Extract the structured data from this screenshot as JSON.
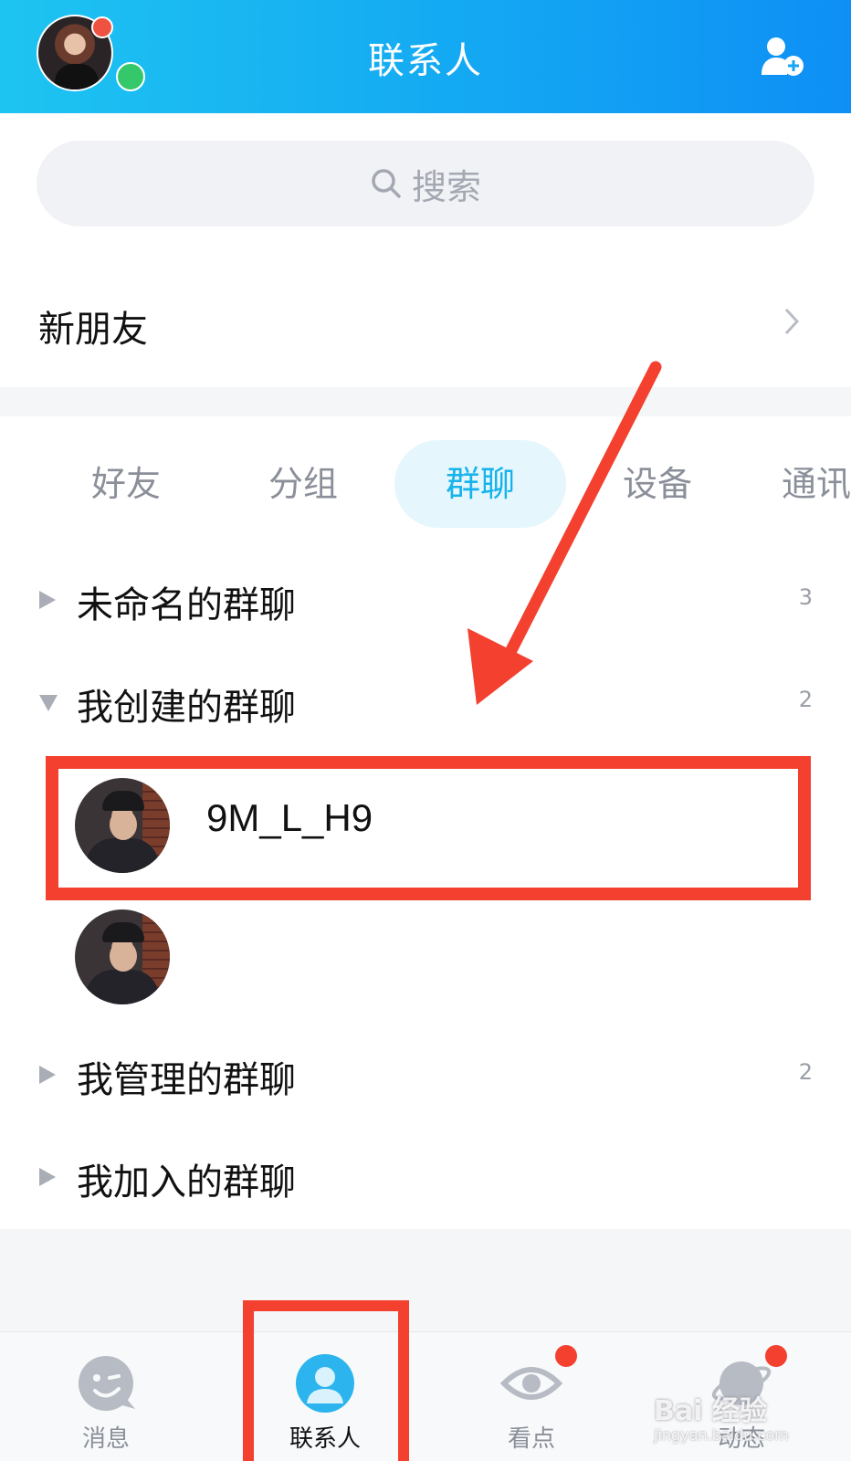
{
  "header": {
    "title": "联系人",
    "add_contact_icon": "add-contact-icon"
  },
  "search": {
    "placeholder": "搜索",
    "icon": "search-icon"
  },
  "new_friends": {
    "label": "新朋友"
  },
  "tabs": [
    {
      "label": "好友",
      "active": false
    },
    {
      "label": "分组",
      "active": false
    },
    {
      "label": "群聊",
      "active": true
    },
    {
      "label": "设备",
      "active": false
    },
    {
      "label": "通讯",
      "active": false
    }
  ],
  "groups": [
    {
      "label": "未命名的群聊",
      "count": "3",
      "expanded": false
    },
    {
      "label": "我创建的群聊",
      "count": "2",
      "expanded": true,
      "items": [
        {
          "name": "9M_L_H9"
        },
        {
          "name": ""
        }
      ]
    },
    {
      "label": "我管理的群聊",
      "count": "2",
      "expanded": false
    },
    {
      "label": "我加入的群聊",
      "count": "",
      "expanded": false
    }
  ],
  "bottom_nav": [
    {
      "label": "消息",
      "icon": "message-icon",
      "active": false,
      "badge": false
    },
    {
      "label": "联系人",
      "icon": "contacts-icon",
      "active": true,
      "badge": false
    },
    {
      "label": "看点",
      "icon": "eye-icon",
      "active": false,
      "badge": true
    },
    {
      "label": "动态",
      "icon": "planet-icon",
      "active": false,
      "badge": true
    }
  ],
  "watermark": {
    "text": "Bai 经验",
    "sub": "jingyan.baidu.com"
  },
  "colors": {
    "header_start": "#1ec4f1",
    "header_end": "#0e8ff5",
    "accent": "#16b3ec",
    "annotation_red": "#f3402f",
    "badge_red": "#f05241",
    "online_green": "#34c86a"
  }
}
